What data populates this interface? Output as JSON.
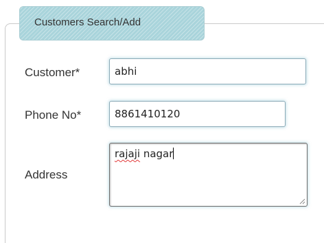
{
  "form": {
    "legend": "Customers Search/Add",
    "fields": {
      "customer": {
        "label": "Customer*",
        "value": "abhi"
      },
      "phone": {
        "label": "Phone No*",
        "value": "8861410120"
      },
      "address": {
        "label": "Address",
        "value_word1": "rajaji",
        "value_rest": " nagar"
      }
    }
  },
  "icons": {
    "resize": "resize-grip-icon"
  },
  "colors": {
    "legend_bg": "#a9d4db",
    "field_border": "#8aa9b6",
    "spellcheck_underline": "#e23b3b"
  }
}
